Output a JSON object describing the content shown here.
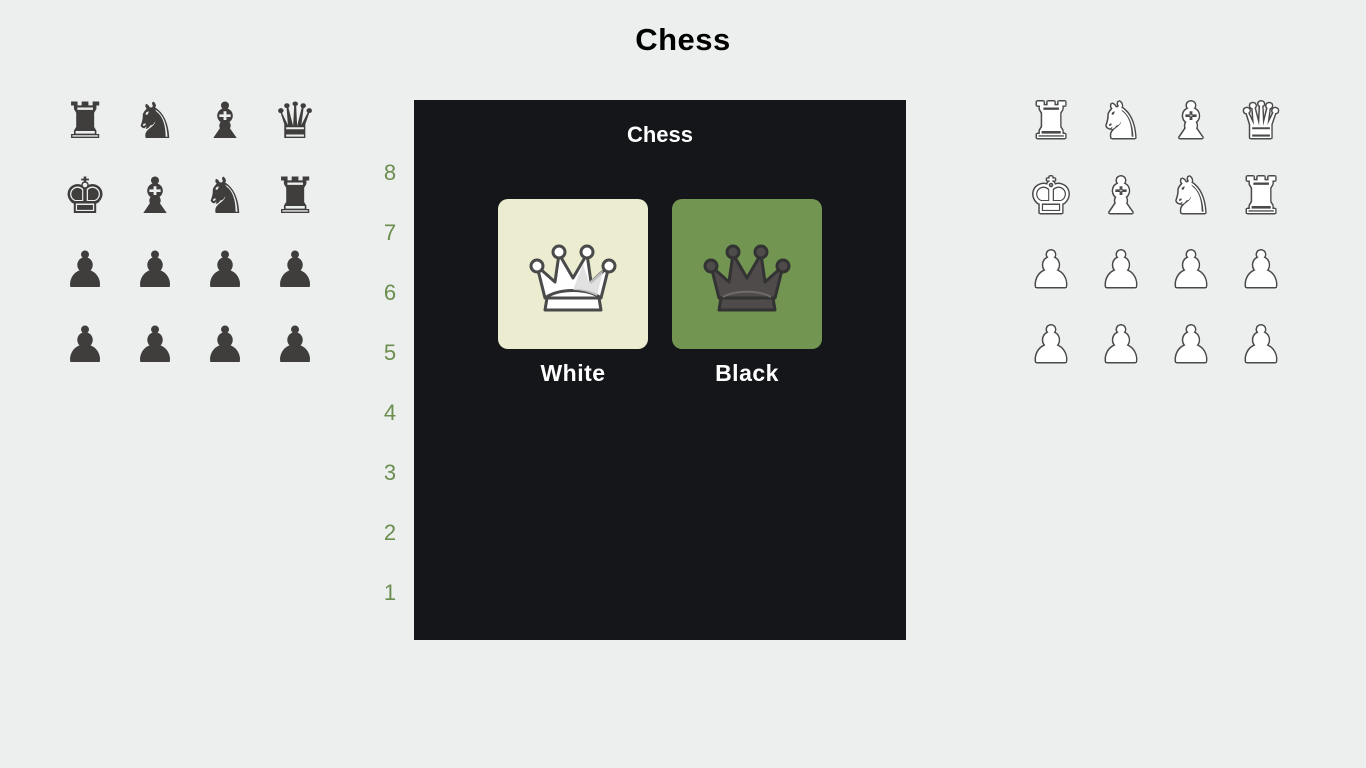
{
  "page": {
    "title": "Chess"
  },
  "panel": {
    "title": "Chess"
  },
  "captured": {
    "black": {
      "color": "#3f3e3d",
      "pieces": [
        {
          "name": "black-rook-icon",
          "glyph": "♜"
        },
        {
          "name": "black-knight-icon",
          "glyph": "♞"
        },
        {
          "name": "black-bishop-icon",
          "glyph": "♝"
        },
        {
          "name": "black-queen-icon",
          "glyph": "♛"
        },
        {
          "name": "black-king-icon",
          "glyph": "♚"
        },
        {
          "name": "black-bishop-icon",
          "glyph": "♝"
        },
        {
          "name": "black-knight-icon",
          "glyph": "♞"
        },
        {
          "name": "black-rook-icon",
          "glyph": "♜"
        },
        {
          "name": "black-pawn-icon",
          "glyph": "♟"
        },
        {
          "name": "black-pawn-icon",
          "glyph": "♟"
        },
        {
          "name": "black-pawn-icon",
          "glyph": "♟"
        },
        {
          "name": "black-pawn-icon",
          "glyph": "♟"
        },
        {
          "name": "black-pawn-icon",
          "glyph": "♟"
        },
        {
          "name": "black-pawn-icon",
          "glyph": "♟"
        },
        {
          "name": "black-pawn-icon",
          "glyph": "♟"
        },
        {
          "name": "black-pawn-icon",
          "glyph": "♟"
        }
      ]
    },
    "white": {
      "color": "#ffffff",
      "pieces": [
        {
          "name": "white-rook-icon",
          "glyph": "♜"
        },
        {
          "name": "white-knight-icon",
          "glyph": "♞"
        },
        {
          "name": "white-bishop-icon",
          "glyph": "♝"
        },
        {
          "name": "white-queen-icon",
          "glyph": "♛"
        },
        {
          "name": "white-king-icon",
          "glyph": "♚"
        },
        {
          "name": "white-bishop-icon",
          "glyph": "♝"
        },
        {
          "name": "white-knight-icon",
          "glyph": "♞"
        },
        {
          "name": "white-rook-icon",
          "glyph": "♜"
        },
        {
          "name": "white-pawn-icon",
          "glyph": "♟"
        },
        {
          "name": "white-pawn-icon",
          "glyph": "♟"
        },
        {
          "name": "white-pawn-icon",
          "glyph": "♟"
        },
        {
          "name": "white-pawn-icon",
          "glyph": "♟"
        },
        {
          "name": "white-pawn-icon",
          "glyph": "♟"
        },
        {
          "name": "white-pawn-icon",
          "glyph": "♟"
        },
        {
          "name": "white-pawn-icon",
          "glyph": "♟"
        },
        {
          "name": "white-pawn-icon",
          "glyph": "♟"
        }
      ]
    }
  },
  "ranks": [
    "8",
    "7",
    "6",
    "5",
    "4",
    "3",
    "2",
    "1"
  ],
  "choices": {
    "white": {
      "label": "White",
      "tile_color": "#ebecd0",
      "icon": "white-queen-icon"
    },
    "black": {
      "label": "Black",
      "tile_color": "#739552",
      "icon": "black-queen-icon"
    }
  },
  "colors": {
    "background": "#ecefee",
    "panel": "#151619",
    "rank_label": "#6b8e4e"
  }
}
